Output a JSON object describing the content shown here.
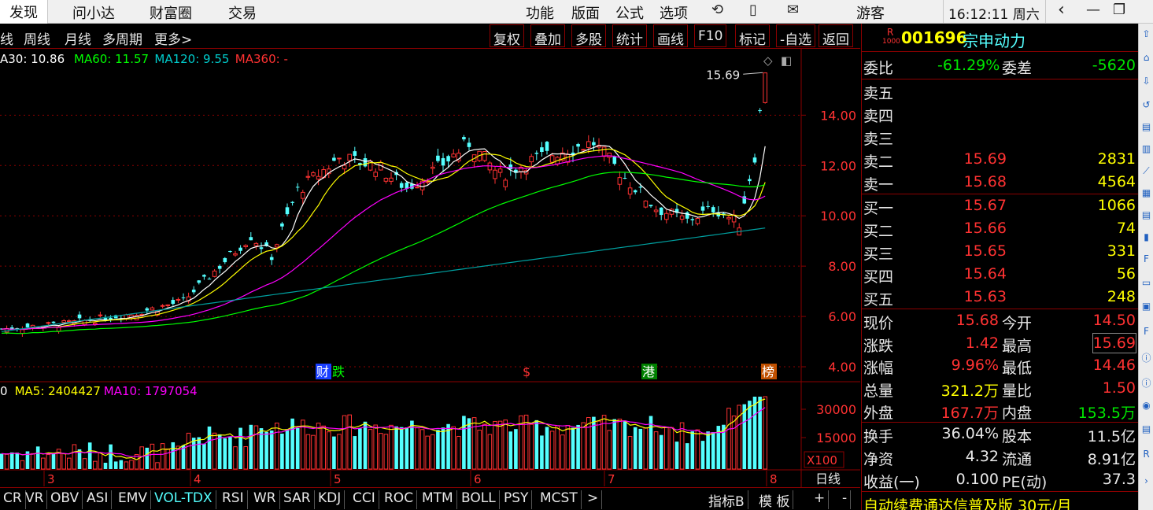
{
  "menubar": {
    "tabs": [
      "发现",
      "问小达",
      "财富圈",
      "交易"
    ],
    "menus": [
      "功能",
      "版面",
      "公式",
      "选项"
    ],
    "user": "游客",
    "clock": "16:12:11 周六",
    "icons": [
      "refresh-icon",
      "phone-icon",
      "message-icon"
    ],
    "window_icons": [
      "back-icon",
      "minimize-icon",
      "restore-icon"
    ]
  },
  "toolbar": {
    "periods": [
      "线",
      "周线",
      "月线",
      "多周期",
      "更多>"
    ],
    "buttons": [
      "复权",
      "叠加",
      "多股",
      "统计",
      "画线",
      "F10",
      "标记",
      "-自选",
      "返回"
    ]
  },
  "ma_legend": [
    {
      "text": "A30: 10.86",
      "color": "#ffffff"
    },
    {
      "text": "MA60: 11.57",
      "color": "#00ff00"
    },
    {
      "text": "MA120: 9.55",
      "color": "#00cccc"
    },
    {
      "text": "MA360: -",
      "color": "#ff3232"
    }
  ],
  "vol_legend": [
    {
      "text": "0",
      "color": "#ffffff"
    },
    {
      "text": "MA5: 2404427",
      "color": "#ffff00"
    },
    {
      "text": "MA10: 1797054",
      "color": "#ff00ff"
    }
  ],
  "chart_data": {
    "type": "candlestick",
    "y_ticks": [
      "14.00",
      "12.00",
      "10.00",
      "8.00",
      "6.00",
      "4.00"
    ],
    "ylim": [
      3.5,
      16.2
    ],
    "high_label": "15.69",
    "x_labels": [
      "3",
      "4",
      "5",
      "6",
      "7",
      "8"
    ],
    "vol_ticks": [
      "30000",
      "15000"
    ],
    "vol_unit": "X100",
    "period_label": "日线",
    "event_markers": [
      {
        "text": "财",
        "color": "#ffffff",
        "bg": "#1a3fff"
      },
      {
        "text": "跌",
        "color": "#00ff00",
        "bg": ""
      },
      {
        "text": "$",
        "color": "#ff3232",
        "bg": ""
      },
      {
        "text": "港",
        "color": "#ffffff",
        "bg": "#008000"
      },
      {
        "text": "榜",
        "color": "#ffffff",
        "bg": "#c05000"
      }
    ],
    "note": "price series recreated approximately from the candlestick chart"
  },
  "quote": {
    "code": "001696",
    "name": "宗申动力",
    "badge": "R",
    "badge_sub": "1000",
    "weibi_label": "委比",
    "weibi": "-61.29%",
    "weicha_label": "委差",
    "weicha": "-5620",
    "sells": [
      {
        "label": "卖五",
        "price": "",
        "vol": ""
      },
      {
        "label": "卖四",
        "price": "",
        "vol": ""
      },
      {
        "label": "卖三",
        "price": "",
        "vol": ""
      },
      {
        "label": "卖二",
        "price": "15.69",
        "vol": "2831"
      },
      {
        "label": "卖一",
        "price": "15.68",
        "vol": "4564"
      }
    ],
    "buys": [
      {
        "label": "买一",
        "price": "15.67",
        "vol": "1066"
      },
      {
        "label": "买二",
        "price": "15.66",
        "vol": "74"
      },
      {
        "label": "买三",
        "price": "15.65",
        "vol": "331"
      },
      {
        "label": "买四",
        "price": "15.64",
        "vol": "56"
      },
      {
        "label": "买五",
        "price": "15.63",
        "vol": "248"
      }
    ],
    "stats": [
      {
        "l1": "现价",
        "v1": "15.68",
        "c1": "red",
        "l2": "今开",
        "v2": "14.50",
        "c2": "red"
      },
      {
        "l1": "涨跌",
        "v1": "1.42",
        "c1": "red",
        "l2": "最高",
        "v2": "15.69",
        "c2": "red"
      },
      {
        "l1": "涨幅",
        "v1": "9.96%",
        "c1": "red",
        "l2": "最低",
        "v2": "14.46",
        "c2": "red"
      },
      {
        "l1": "总量",
        "v1": "321.2万",
        "c1": "yellow",
        "l2": "量比",
        "v2": "1.50",
        "c2": "red"
      },
      {
        "l1": "外盘",
        "v1": "167.7万",
        "c1": "red",
        "l2": "内盘",
        "v2": "153.5万",
        "c2": "green"
      }
    ],
    "fin": [
      {
        "l1": "换手",
        "v1": "36.04%",
        "l2": "股本",
        "v2": "11.5亿"
      },
      {
        "l1": "净资",
        "v1": "4.32",
        "l2": "流通",
        "v2": "8.91亿"
      },
      {
        "l1": "收益(一)",
        "v1": "0.100",
        "l2": "PE(动)",
        "v2": "37.3"
      }
    ],
    "ad": "自动续费通达信普及版 30元/月"
  },
  "bottombar": {
    "indicators": [
      "CR",
      "VR",
      "OBV",
      "ASI",
      "EMV",
      "VOL-TDX",
      "RSI",
      "WR",
      "SAR",
      "KDJ",
      "CCI",
      "ROC",
      "MTM",
      "BOLL",
      "PSY",
      "MCST",
      ">"
    ],
    "active": "VOL-TDX",
    "right": [
      "指标B",
      "模 板",
      "+",
      "-"
    ]
  },
  "colors": {
    "up": "#ff3232",
    "down": "#54ffff",
    "grid": "#8b0000",
    "axis_text": "#ff3232",
    "ma5": "#ffffff",
    "ma10": "#ffff00",
    "ma30": "#ff00ff",
    "ma60": "#00ff00",
    "ma120": "#00a0a0"
  }
}
